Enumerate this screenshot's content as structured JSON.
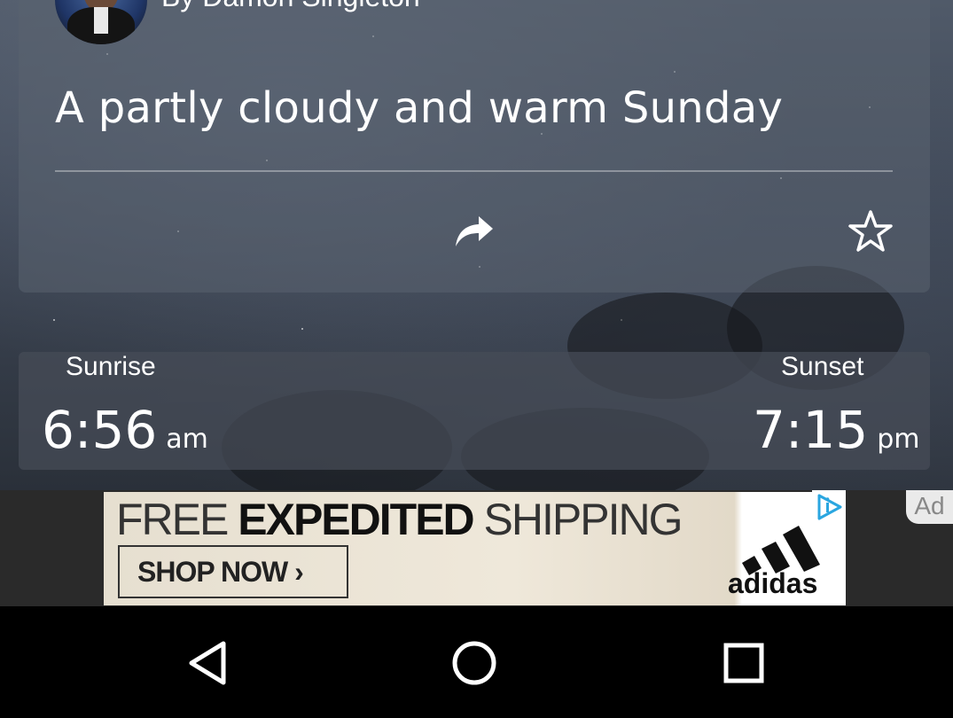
{
  "article": {
    "byline": "By Damon Singleton",
    "headline": "A partly cloudy and warm Sunday",
    "actions": {
      "share_icon": "share-icon",
      "favorite_icon": "star-icon"
    }
  },
  "sun": {
    "sunrise_label": "Sunrise",
    "sunrise_time": "6:56",
    "sunrise_suffix": "am",
    "sunset_label": "Sunset",
    "sunset_time": "7:15",
    "sunset_suffix": "pm"
  },
  "ad": {
    "headline_light": "FREE ",
    "headline_bold": "EXPEDITED",
    "headline_tail": " SHIPPING",
    "cta": "SHOP NOW ›",
    "brand": "adidas",
    "label": "Ad"
  },
  "nav": {
    "back_icon": "back-icon",
    "home_icon": "home-icon",
    "recents_icon": "recents-icon"
  }
}
